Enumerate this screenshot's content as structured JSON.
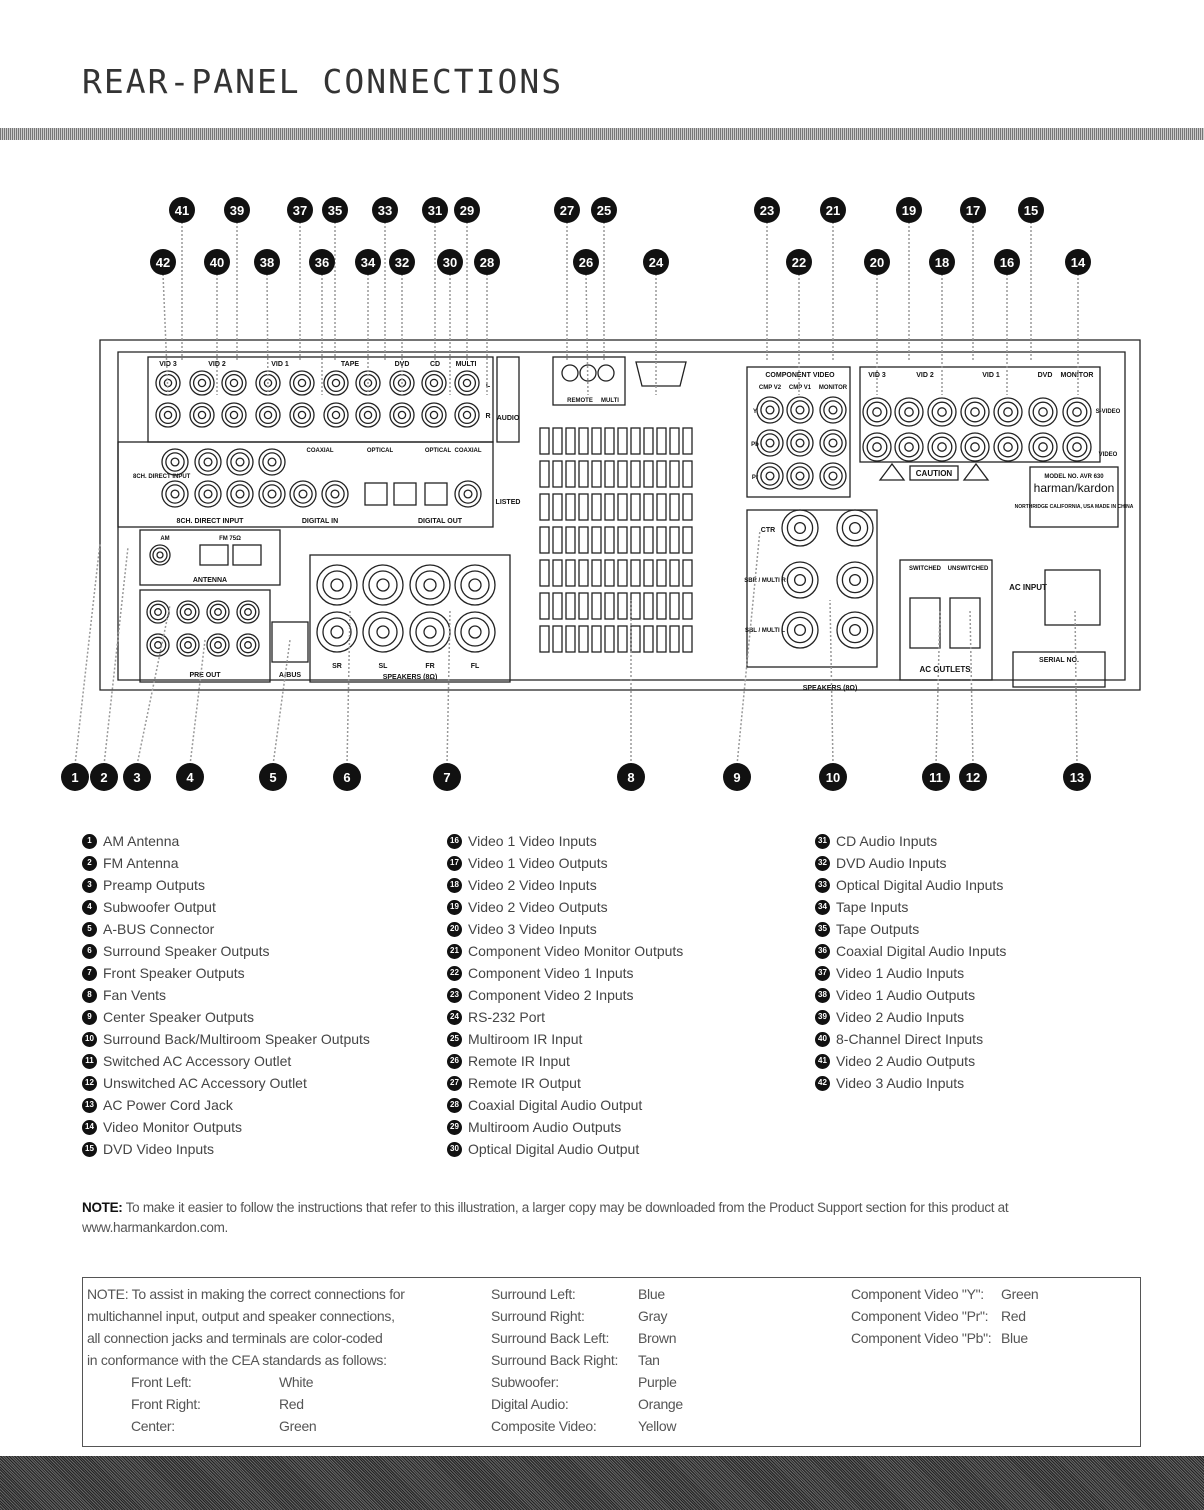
{
  "page_title": "REAR-PANEL CONNECTIONS",
  "callouts_top": [
    "41",
    "39",
    "37",
    "35",
    "33",
    "31",
    "29",
    "27",
    "25",
    "23",
    "21",
    "19",
    "17",
    "15"
  ],
  "callouts_mid": [
    "42",
    "40",
    "38",
    "36",
    "34",
    "32",
    "30",
    "28",
    "26",
    "24",
    "22",
    "20",
    "18",
    "16",
    "14"
  ],
  "callouts_bottom": [
    "1",
    "2",
    "3",
    "4",
    "5",
    "6",
    "7",
    "8",
    "9",
    "10",
    "11",
    "12",
    "13"
  ],
  "panel_labels": {
    "vid3": "VID 3",
    "vid2": "VID 2",
    "vid1": "VID 1",
    "tape": "TAPE",
    "dvd": "DVD",
    "cd": "CD",
    "multi": "MULTI",
    "audio": "AUDIO",
    "l": "L",
    "r": "R",
    "eight_ch": "8CH. DIRECT INPUT",
    "eight_ch_side": "8CH. DIRECT INPUT",
    "coaxial": "COAXIAL",
    "optical": "OPTICAL",
    "digital_in": "DIGITAL IN",
    "digital_out": "DIGITAL OUT",
    "antenna": "ANTENNA",
    "am": "AM",
    "fm": "FM 75Ω",
    "preout": "PRE OUT",
    "abus": "A-BUS",
    "speakers_8ohm": "SPEAKERS (8Ω)",
    "sr": "SR",
    "sl": "SL",
    "fr": "FR",
    "fl": "FL",
    "component_video": "COMPONENT VIDEO",
    "comp_v2": "CMP V2",
    "comp_v1": "CMP V1",
    "monitor": "MONITOR",
    "y": "Y",
    "pb": "Pb",
    "pr": "Pr",
    "in": "IN",
    "out": "OUT",
    "svideo": "S-VIDEO",
    "video": "VIDEO",
    "remote": "REMOTE",
    "multi_ir": "MULTI",
    "caution": "CAUTION",
    "ctr": "CTR",
    "sbr": "SBR / MULTI R",
    "sbl": "SBL / MULTI L",
    "switched": "SWITCHED",
    "unswitched": "UNSWITCHED",
    "ac_outlets": "AC OUTLETS",
    "ac_input": "AC INPUT",
    "model": "MODEL NO. AVR 630",
    "brand": "harman/kardon",
    "origin": "NORTHRIDGE CALIFORNIA, USA MADE IN CHINA",
    "serial": "SERIAL NO.",
    "listed": "LISTED"
  },
  "legend": [
    {
      "n": "1",
      "label": "AM Antenna"
    },
    {
      "n": "2",
      "label": "FM Antenna"
    },
    {
      "n": "3",
      "label": "Preamp Outputs"
    },
    {
      "n": "4",
      "label": "Subwoofer Output"
    },
    {
      "n": "5",
      "label": "A-BUS Connector"
    },
    {
      "n": "6",
      "label": "Surround Speaker Outputs"
    },
    {
      "n": "7",
      "label": "Front Speaker Outputs"
    },
    {
      "n": "8",
      "label": "Fan Vents"
    },
    {
      "n": "9",
      "label": "Center Speaker Outputs"
    },
    {
      "n": "10",
      "label": "Surround Back/Multiroom Speaker Outputs"
    },
    {
      "n": "11",
      "label": "Switched AC Accessory Outlet"
    },
    {
      "n": "12",
      "label": "Unswitched AC Accessory Outlet"
    },
    {
      "n": "13",
      "label": "AC Power Cord Jack"
    },
    {
      "n": "14",
      "label": "Video Monitor Outputs"
    },
    {
      "n": "15",
      "label": "DVD Video Inputs"
    },
    {
      "n": "16",
      "label": "Video 1 Video Inputs"
    },
    {
      "n": "17",
      "label": "Video 1 Video Outputs"
    },
    {
      "n": "18",
      "label": "Video 2 Video Inputs"
    },
    {
      "n": "19",
      "label": "Video 2 Video Outputs"
    },
    {
      "n": "20",
      "label": "Video 3 Video Inputs"
    },
    {
      "n": "21",
      "label": "Component Video Monitor Outputs"
    },
    {
      "n": "22",
      "label": "Component Video 1 Inputs"
    },
    {
      "n": "23",
      "label": "Component Video 2 Inputs"
    },
    {
      "n": "24",
      "label": "RS-232 Port"
    },
    {
      "n": "25",
      "label": "Multiroom IR Input"
    },
    {
      "n": "26",
      "label": "Remote IR Input"
    },
    {
      "n": "27",
      "label": "Remote IR Output"
    },
    {
      "n": "28",
      "label": "Coaxial Digital Audio Output"
    },
    {
      "n": "29",
      "label": "Multiroom Audio Outputs"
    },
    {
      "n": "30",
      "label": "Optical Digital Audio Output"
    },
    {
      "n": "31",
      "label": "CD Audio Inputs"
    },
    {
      "n": "32",
      "label": "DVD Audio Inputs"
    },
    {
      "n": "33",
      "label": "Optical Digital Audio Inputs"
    },
    {
      "n": "34",
      "label": "Tape Inputs"
    },
    {
      "n": "35",
      "label": "Tape Outputs"
    },
    {
      "n": "36",
      "label": "Coaxial Digital Audio Inputs"
    },
    {
      "n": "37",
      "label": "Video 1 Audio Inputs"
    },
    {
      "n": "38",
      "label": "Video 1 Audio Outputs"
    },
    {
      "n": "39",
      "label": "Video 2 Audio Inputs"
    },
    {
      "n": "40",
      "label": "8-Channel Direct Inputs"
    },
    {
      "n": "41",
      "label": "Video 2 Audio Outputs"
    },
    {
      "n": "42",
      "label": "Video 3 Audio Inputs"
    }
  ],
  "note": {
    "prefix": "NOTE:",
    "text": "To make it easier to follow the instructions that refer to this illustration, a larger copy may be downloaded from the Product Support section for this product at",
    "url": "www.harmankardon.com."
  },
  "color_box": {
    "intro": [
      "NOTE: To assist in making the correct connections for",
      "multichannel input, output and speaker connections,",
      "all connection jacks and terminals are color-coded",
      "in conformance with the CEA standards as follows:"
    ],
    "col1": [
      {
        "k": "Front Left:",
        "v": "White"
      },
      {
        "k": "Front Right:",
        "v": "Red"
      },
      {
        "k": "Center:",
        "v": "Green"
      }
    ],
    "col2": [
      {
        "k": "Surround Left:",
        "v": "Blue"
      },
      {
        "k": "Surround Right:",
        "v": "Gray"
      },
      {
        "k": "Surround Back Left:",
        "v": "Brown"
      },
      {
        "k": "Surround Back Right:",
        "v": "Tan"
      },
      {
        "k": "Subwoofer:",
        "v": "Purple"
      },
      {
        "k": "Digital Audio:",
        "v": "Orange"
      },
      {
        "k": "Composite Video:",
        "v": "Yellow"
      }
    ],
    "col3": [
      {
        "k": "Component Video \"Y\":",
        "v": "Green"
      },
      {
        "k": "Component Video \"Pr\":",
        "v": "Red"
      },
      {
        "k": "Component Video \"Pb\":",
        "v": "Blue"
      }
    ]
  }
}
